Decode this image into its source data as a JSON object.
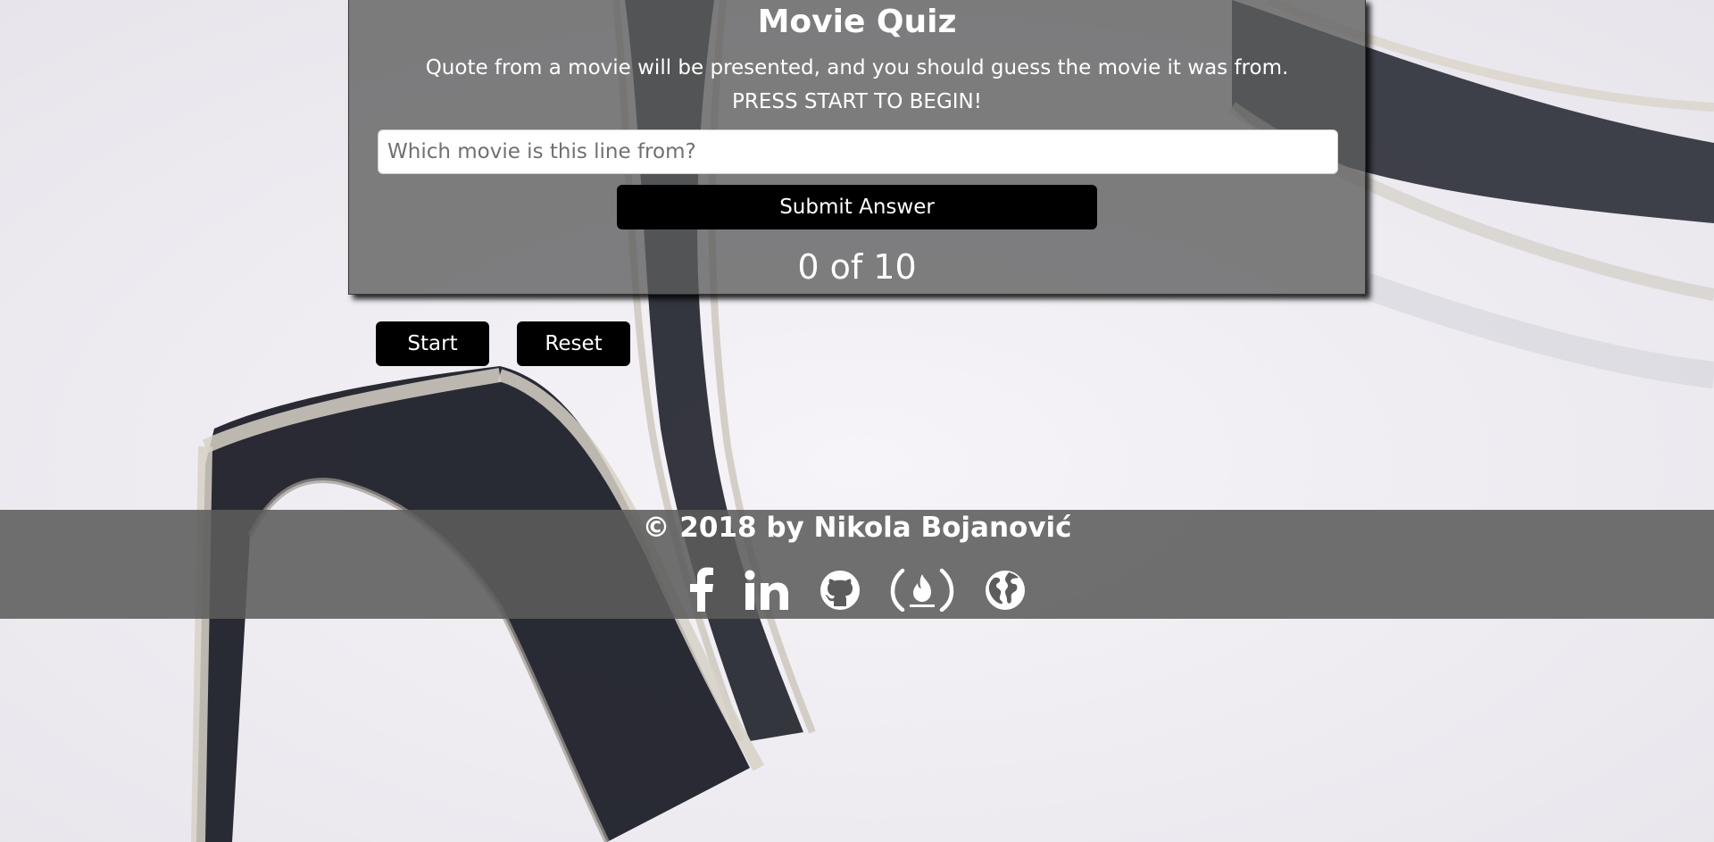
{
  "quiz": {
    "title": "Movie Quiz",
    "description": "Quote from a movie will be presented, and you should guess the movie it was from. PRESS START TO BEGIN!",
    "answer_placeholder": "Which movie is this line from?",
    "answer_value": "",
    "submit_label": "Submit Answer",
    "progress": "0 of 10"
  },
  "controls": {
    "start_label": "Start",
    "reset_label": "Reset"
  },
  "footer": {
    "copyright": "© 2018 by Nikola Bojanović",
    "social_icons": [
      "facebook-icon",
      "linkedin-icon",
      "github-icon",
      "freecodecamp-icon",
      "globe-icon"
    ]
  },
  "colors": {
    "panel_bg": "#5c5c5c",
    "button_bg": "#000000",
    "text": "#ffffff",
    "page_bg": "#ece9ef"
  }
}
